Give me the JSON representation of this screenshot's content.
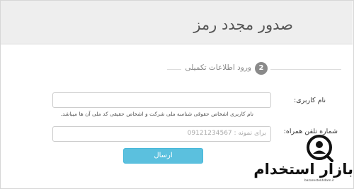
{
  "header": {
    "title": "صدور مجدد رمز"
  },
  "step": {
    "number": "2",
    "label": "ورود اطلاعات تکمیلی"
  },
  "form": {
    "username": {
      "label": "نام کاربری:",
      "value": "",
      "help": "نام کاربری اشخاص حقوقی شناسه ملی شرکت و اشخاص حقیقی کد ملی آن ها میباشد."
    },
    "phone": {
      "label": "شماره تلفن همراه:",
      "placeholder": "برای نمونه : 09121234567"
    },
    "submit_label": "ارسال"
  },
  "watermark": {
    "text": "بازار استخدام",
    "subtext": "bazarestekhdam.ir",
    "icon": "person-search-icon"
  },
  "colors": {
    "header_bg": "#eeeeee",
    "button": "#5bc0de",
    "badge": "#8a8a8a"
  }
}
